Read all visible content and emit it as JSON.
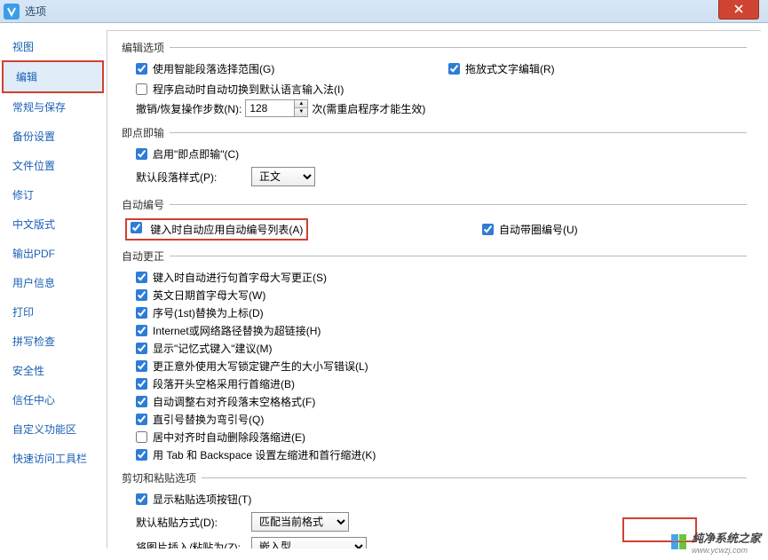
{
  "window": {
    "title": "选项"
  },
  "sidebar": {
    "items": [
      {
        "label": "视图"
      },
      {
        "label": "编辑"
      },
      {
        "label": "常规与保存"
      },
      {
        "label": "备份设置"
      },
      {
        "label": "文件位置"
      },
      {
        "label": "修订"
      },
      {
        "label": "中文版式"
      },
      {
        "label": "输出PDF"
      },
      {
        "label": "用户信息"
      },
      {
        "label": "打印"
      },
      {
        "label": "拼写检查"
      },
      {
        "label": "安全性"
      },
      {
        "label": "信任中心"
      },
      {
        "label": "自定义功能区"
      },
      {
        "label": "快速访问工具栏"
      }
    ]
  },
  "sections": {
    "edit_options": {
      "legend": "编辑选项",
      "smart_paragraph": "使用智能段落选择范围(G)",
      "drag_edit": "拖放式文字编辑(R)",
      "auto_switch_ime": "程序启动时自动切换到默认语言输入法(I)",
      "undo_label": "撤销/恢复操作步数(N):",
      "undo_value": "128",
      "undo_suffix": "次(需重启程序才能生效)"
    },
    "instant_input": {
      "legend": "即点即输",
      "enable": "启用\"即点即输\"(C)",
      "default_style_label": "默认段落样式(P):",
      "default_style_value": "正文"
    },
    "auto_number": {
      "legend": "自动编号",
      "auto_apply_list": "键入时自动应用自动编号列表(A)",
      "circle_number": "自动带圈编号(U)"
    },
    "auto_correct": {
      "legend": "自动更正",
      "sentence_cap": "键入时自动进行句首字母大写更正(S)",
      "date_cap": "英文日期首字母大写(W)",
      "ordinal_super": "序号(1st)替换为上标(D)",
      "url_link": "Internet或网络路径替换为超链接(H)",
      "memory_input": "显示\"记忆式键入\"建议(M)",
      "caps_lock_error": "更正意外使用大写锁定键产生的大小写错误(L)",
      "first_line_indent": "段落开头空格采用行首缩进(B)",
      "auto_adjust_space": "自动调整右对齐段落末空格格式(F)",
      "smart_quotes": "直引号替换为弯引号(Q)",
      "center_remove_indent": "居中对齐时自动删除段落缩进(E)",
      "tab_backspace": "用 Tab 和 Backspace 设置左缩进和首行缩进(K)"
    },
    "cut_paste": {
      "legend": "剪切和粘贴选项",
      "show_paste_button": "显示粘贴选项按钮(T)",
      "default_paste_label": "默认粘贴方式(D):",
      "default_paste_value": "匹配当前格式",
      "paste_image_label": "将图片插入/粘贴为(Z):",
      "paste_image_value": "嵌入型"
    }
  },
  "watermark": {
    "text": "纯净系统之家",
    "url": "www.ycwzj.com"
  }
}
